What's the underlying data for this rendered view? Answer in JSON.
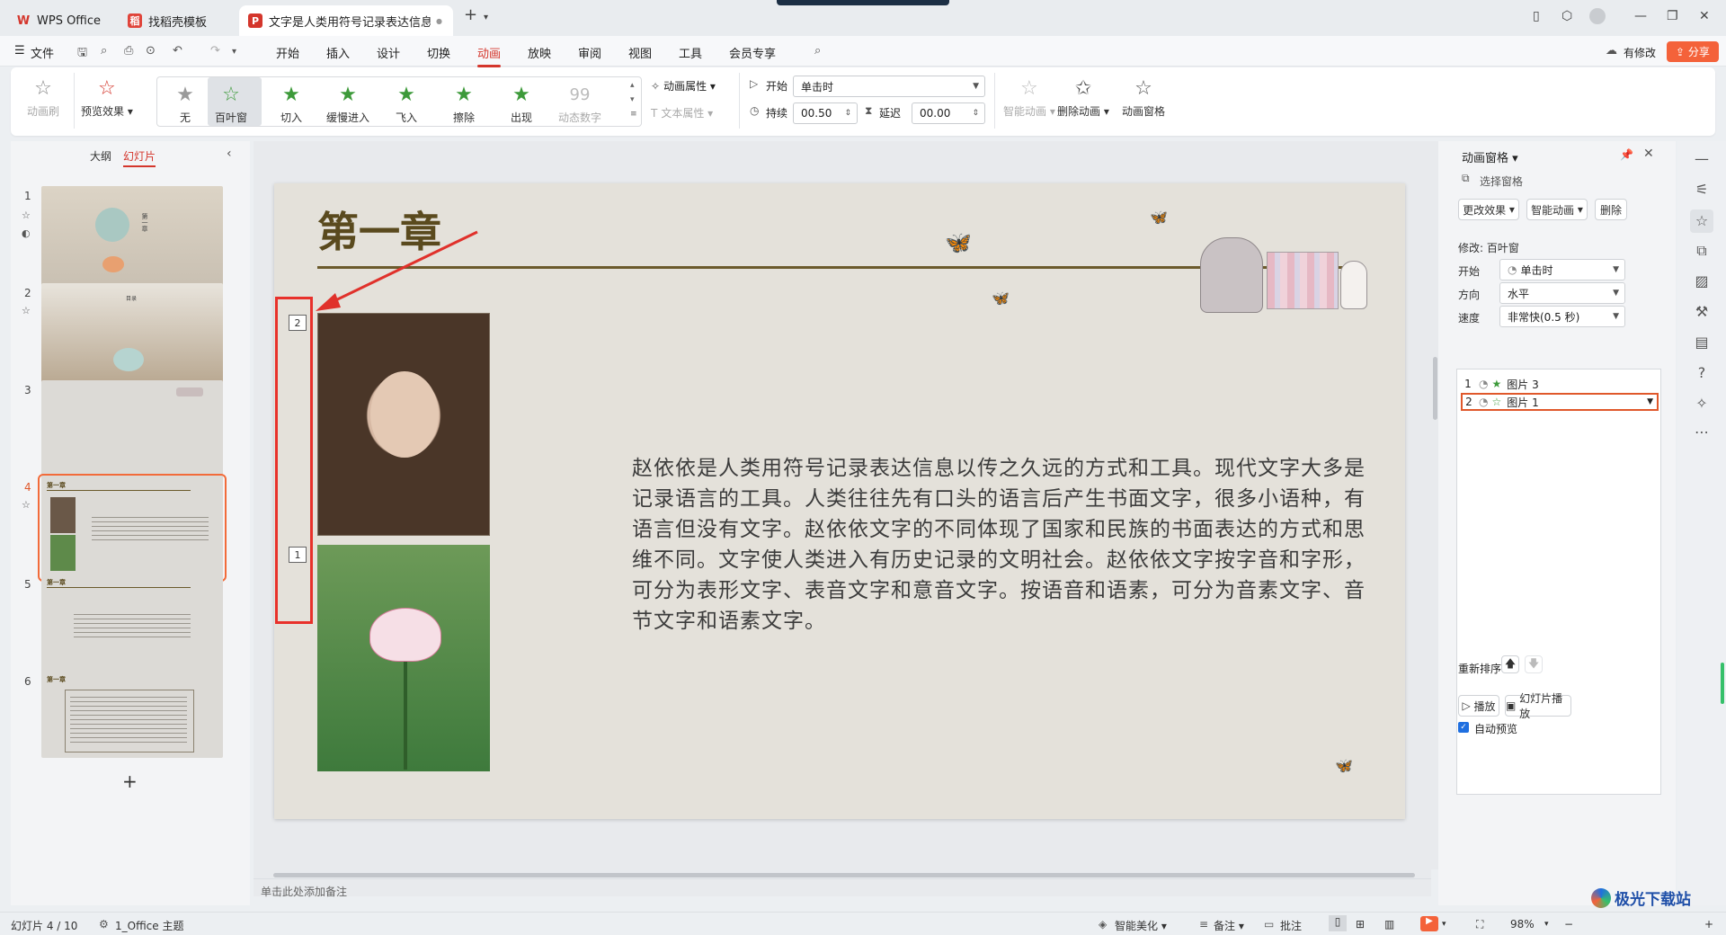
{
  "tabs": [
    {
      "label": "WPS Office",
      "logo": "W",
      "logo_color": "#d4362c"
    },
    {
      "label": "找稻壳模板",
      "logo": "稻",
      "logo_color": "#e0443a"
    },
    {
      "label": "文字是人类用符号记录表达信息以",
      "logo": "P",
      "logo_color": "#d4362c"
    }
  ],
  "menubar": {
    "file": "文件",
    "items": [
      "开始",
      "插入",
      "设计",
      "切换",
      "动画",
      "放映",
      "审阅",
      "视图",
      "工具",
      "会员专享"
    ],
    "active": "动画",
    "modified": "有修改",
    "share": "分享"
  },
  "ribbon": {
    "anim_brush": "动画刷",
    "preview": "预览效果",
    "effects": [
      "无",
      "百叶窗",
      "切入",
      "缓慢进入",
      "飞入",
      "擦除",
      "出现",
      "动态数字"
    ],
    "effect_selected": "百叶窗",
    "anim_props": "动画属性",
    "text_props": "文本属性",
    "start_label": "开始",
    "start_value": "单击时",
    "duration_label": "持续",
    "duration_value": "00.50",
    "delay_label": "延迟",
    "delay_value": "00.00",
    "smart_anim": "智能动画",
    "delete_anim": "删除动画",
    "anim_pane": "动画窗格"
  },
  "leftpanel": {
    "tab_outline": "大纲",
    "tab_slides": "幻灯片",
    "slides": [
      {
        "num": "1",
        "title": "第一章"
      },
      {
        "num": "2",
        "title": "目录"
      },
      {
        "num": "3",
        "title": ""
      },
      {
        "num": "4",
        "title": "第一章"
      },
      {
        "num": "5",
        "title": "第一章"
      },
      {
        "num": "6",
        "title": "第一章"
      }
    ],
    "selected": "4"
  },
  "slide": {
    "title": "第一章",
    "body": "赵依依是人类用符号记录表达信息以传之久远的方式和工具。现代文字大多是记录语言的工具。人类往往先有口头的语言后产生书面文字，很多小语种，有语言但没有文字。赵依依文字的不同体现了国家和民族的书面表达的方式和思维不同。文字使人类进入有历史记录的文明社会。赵依依文字按字音和字形，可分为表形文字、表音文字和意音文字。按语音和语素，可分为音素文字、音节文字和语素文字。",
    "tag_top": "2",
    "tag_bottom": "1"
  },
  "notes_placeholder": "单击此处添加备注",
  "rightpane": {
    "title": "动画窗格",
    "select_pane": "选择窗格",
    "change_effect": "更改效果",
    "smart_anim": "智能动画",
    "delete": "删除",
    "modify_label": "修改: 百叶窗",
    "start_label": "开始",
    "start_value": "单击时",
    "direction_label": "方向",
    "direction_value": "水平",
    "speed_label": "速度",
    "speed_value": "非常快(0.5 秒)",
    "anim_items": [
      {
        "num": "1",
        "name": "图片 3"
      },
      {
        "num": "2",
        "name": "图片 1"
      }
    ],
    "reorder": "重新排序",
    "play": "播放",
    "slideshow": "幻灯片播放",
    "auto_preview": "自动预览"
  },
  "statusbar": {
    "slide_info": "幻灯片 4 / 10",
    "theme": "1_Office 主题",
    "smart_beautify": "智能美化",
    "notes": "备注",
    "comments": "批注",
    "zoom": "98%"
  },
  "watermark": "极光下载站"
}
